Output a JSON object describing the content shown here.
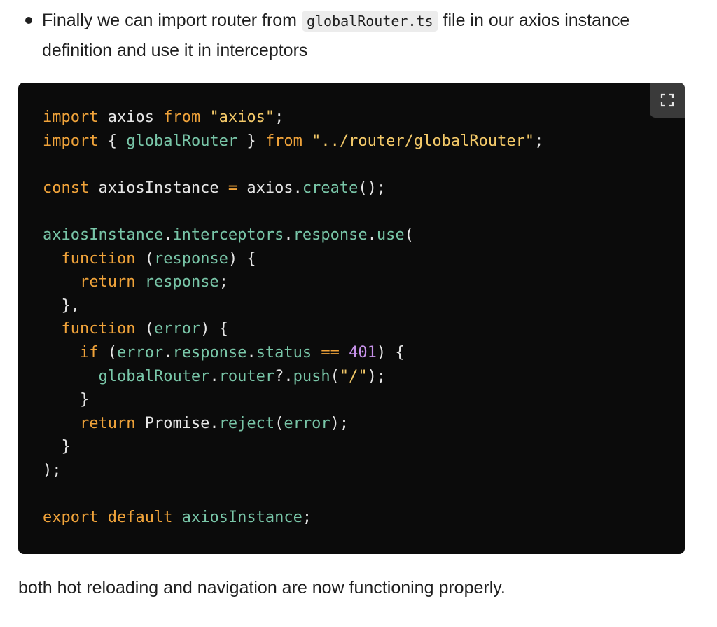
{
  "bullet": {
    "text_before": "Finally we can import router from ",
    "inline_code": "globalRouter.ts",
    "text_after": " file in our axios instance definition and use it in interceptors"
  },
  "code_block": {
    "expand_icon": "expand-icon",
    "lines": [
      [
        {
          "t": "kw",
          "v": "import"
        },
        {
          "t": "plain",
          "v": " axios "
        },
        {
          "t": "kw",
          "v": "from"
        },
        {
          "t": "plain",
          "v": " "
        },
        {
          "t": "str",
          "v": "\"axios\""
        },
        {
          "t": "punc",
          "v": ";"
        }
      ],
      [
        {
          "t": "kw",
          "v": "import"
        },
        {
          "t": "plain",
          "v": " { "
        },
        {
          "t": "id",
          "v": "globalRouter"
        },
        {
          "t": "plain",
          "v": " } "
        },
        {
          "t": "kw",
          "v": "from"
        },
        {
          "t": "plain",
          "v": " "
        },
        {
          "t": "str",
          "v": "\"../router/globalRouter\""
        },
        {
          "t": "punc",
          "v": ";"
        }
      ],
      [],
      [
        {
          "t": "kw",
          "v": "const"
        },
        {
          "t": "plain",
          "v": " axiosInstance "
        },
        {
          "t": "op",
          "v": "="
        },
        {
          "t": "plain",
          "v": " axios."
        },
        {
          "t": "id",
          "v": "create"
        },
        {
          "t": "punc",
          "v": "();"
        }
      ],
      [],
      [
        {
          "t": "id",
          "v": "axiosInstance"
        },
        {
          "t": "plain",
          "v": "."
        },
        {
          "t": "id",
          "v": "interceptors"
        },
        {
          "t": "plain",
          "v": "."
        },
        {
          "t": "id",
          "v": "response"
        },
        {
          "t": "plain",
          "v": "."
        },
        {
          "t": "id",
          "v": "use"
        },
        {
          "t": "punc",
          "v": "("
        }
      ],
      [
        {
          "t": "plain",
          "v": "  "
        },
        {
          "t": "kw",
          "v": "function"
        },
        {
          "t": "plain",
          "v": " ("
        },
        {
          "t": "id",
          "v": "response"
        },
        {
          "t": "plain",
          "v": ") {"
        }
      ],
      [
        {
          "t": "plain",
          "v": "    "
        },
        {
          "t": "kw",
          "v": "return"
        },
        {
          "t": "plain",
          "v": " "
        },
        {
          "t": "id",
          "v": "response"
        },
        {
          "t": "punc",
          "v": ";"
        }
      ],
      [
        {
          "t": "plain",
          "v": "  },"
        }
      ],
      [
        {
          "t": "plain",
          "v": "  "
        },
        {
          "t": "kw",
          "v": "function"
        },
        {
          "t": "plain",
          "v": " ("
        },
        {
          "t": "id",
          "v": "error"
        },
        {
          "t": "plain",
          "v": ") {"
        }
      ],
      [
        {
          "t": "plain",
          "v": "    "
        },
        {
          "t": "kw",
          "v": "if"
        },
        {
          "t": "plain",
          "v": " ("
        },
        {
          "t": "id",
          "v": "error"
        },
        {
          "t": "plain",
          "v": "."
        },
        {
          "t": "id",
          "v": "response"
        },
        {
          "t": "plain",
          "v": "."
        },
        {
          "t": "id",
          "v": "status"
        },
        {
          "t": "plain",
          "v": " "
        },
        {
          "t": "op",
          "v": "=="
        },
        {
          "t": "plain",
          "v": " "
        },
        {
          "t": "num",
          "v": "401"
        },
        {
          "t": "plain",
          "v": ") {"
        }
      ],
      [
        {
          "t": "plain",
          "v": "      "
        },
        {
          "t": "id",
          "v": "globalRouter"
        },
        {
          "t": "plain",
          "v": "."
        },
        {
          "t": "id",
          "v": "router"
        },
        {
          "t": "plain",
          "v": "?."
        },
        {
          "t": "id",
          "v": "push"
        },
        {
          "t": "plain",
          "v": "("
        },
        {
          "t": "str",
          "v": "\"/\""
        },
        {
          "t": "punc",
          "v": ");"
        }
      ],
      [
        {
          "t": "plain",
          "v": "    }"
        }
      ],
      [
        {
          "t": "plain",
          "v": "    "
        },
        {
          "t": "kw",
          "v": "return"
        },
        {
          "t": "plain",
          "v": " Promise."
        },
        {
          "t": "id",
          "v": "reject"
        },
        {
          "t": "plain",
          "v": "("
        },
        {
          "t": "id",
          "v": "error"
        },
        {
          "t": "punc",
          "v": ");"
        }
      ],
      [
        {
          "t": "plain",
          "v": "  }"
        }
      ],
      [
        {
          "t": "punc",
          "v": ");"
        }
      ],
      [],
      [
        {
          "t": "kw",
          "v": "export"
        },
        {
          "t": "plain",
          "v": " "
        },
        {
          "t": "kw",
          "v": "default"
        },
        {
          "t": "plain",
          "v": " "
        },
        {
          "t": "id",
          "v": "axiosInstance"
        },
        {
          "t": "punc",
          "v": ";"
        }
      ]
    ]
  },
  "footer_text": "both hot reloading and navigation are now functioning properly.",
  "colors": {
    "code_bg": "#0b0b0b",
    "keyword": "#f0a33a",
    "string": "#f3c969",
    "number": "#c792ea",
    "identifier": "#79c6a8",
    "plain": "#e6e6e6"
  }
}
